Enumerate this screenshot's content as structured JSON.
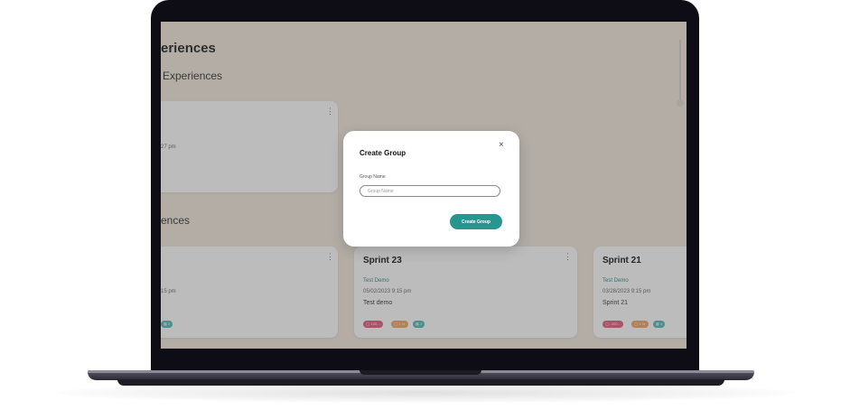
{
  "page": {
    "heading": "eriences",
    "subheading": "Experiences",
    "section2_heading": "ences"
  },
  "top_card": {
    "time_fragment": "27 pm"
  },
  "cards": [
    {
      "time_fragment": "15 pm"
    },
    {
      "title": "Sprint 23",
      "link": "Test Demo",
      "datetime": "05/02/2023  9:15 pm",
      "description": "Test demo",
      "badges": [
        "100...",
        "1 hr",
        "4"
      ]
    },
    {
      "title": "Sprint 21",
      "link": "Test Demo",
      "datetime": "03/28/2023  9:15 pm",
      "description": "Sprint 21",
      "badges": [
        "-100...",
        "1 hr",
        "4"
      ]
    }
  ],
  "modal": {
    "title": "Create Group",
    "close_glyph": "×",
    "field_label": "Group Name",
    "field_placeholder": "Group Name",
    "field_value": "",
    "submit_label": "Create Group"
  },
  "icons": {
    "kebab": "⋮"
  },
  "colors": {
    "accent": "#2a9490",
    "page_bg": "#f1e8dd",
    "badge_red": "#e75a7c",
    "badge_orange": "#f0a35e",
    "badge_teal": "#52b7b7"
  }
}
